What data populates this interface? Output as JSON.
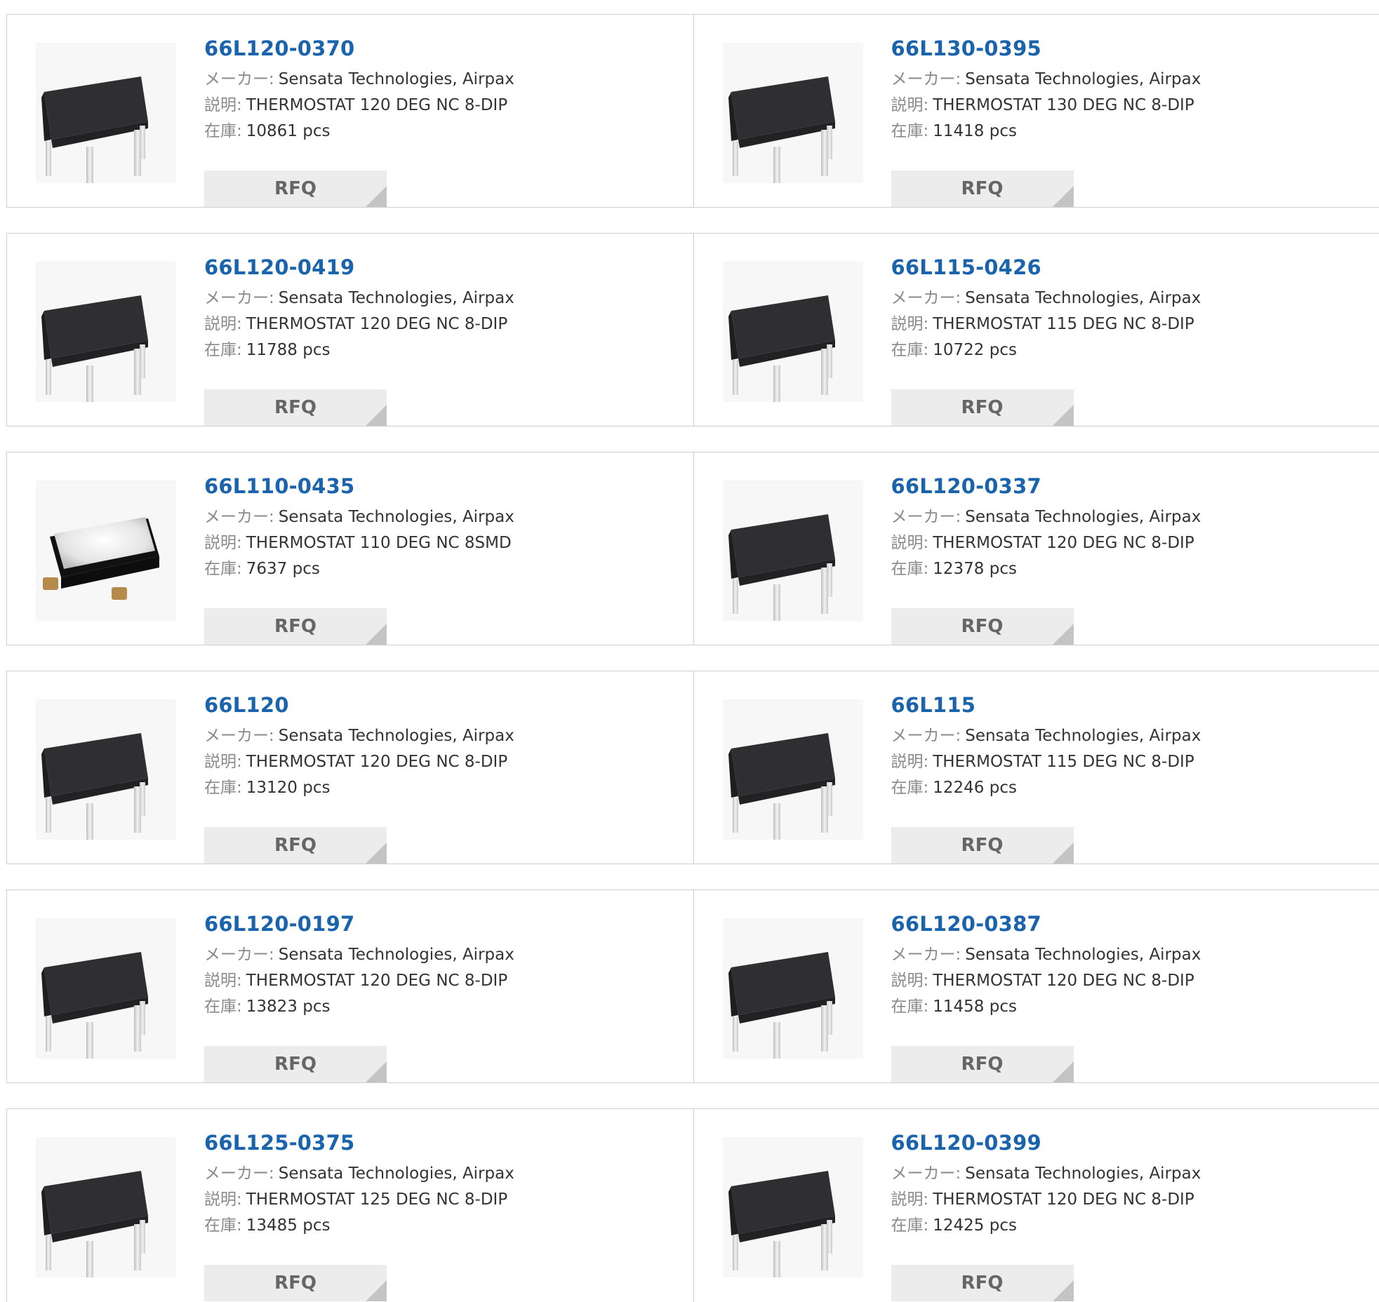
{
  "products": [
    {
      "part": "66L120-0370",
      "maker_label": "メーカー:",
      "maker": "Sensata Technologies, Airpax",
      "desc_label": "説明:",
      "desc": "THERMOSTAT 120 DEG NC 8-DIP",
      "stock_label": "在庫:",
      "stock": "10861 pcs",
      "rfq": "RFQ",
      "image": "dip-thermostat-icon"
    },
    {
      "part": "66L130-0395",
      "maker_label": "メーカー:",
      "maker": "Sensata Technologies, Airpax",
      "desc_label": "説明:",
      "desc": "THERMOSTAT 130 DEG NC 8-DIP",
      "stock_label": "在庫:",
      "stock": "11418 pcs",
      "rfq": "RFQ",
      "image": "dip-thermostat-icon"
    },
    {
      "part": "66L120-0419",
      "maker_label": "メーカー:",
      "maker": "Sensata Technologies, Airpax",
      "desc_label": "説明:",
      "desc": "THERMOSTAT 120 DEG NC 8-DIP",
      "stock_label": "在庫:",
      "stock": "11788 pcs",
      "rfq": "RFQ",
      "image": "dip-thermostat-icon"
    },
    {
      "part": "66L115-0426",
      "maker_label": "メーカー:",
      "maker": "Sensata Technologies, Airpax",
      "desc_label": "説明:",
      "desc": "THERMOSTAT 115 DEG NC 8-DIP",
      "stock_label": "在庫:",
      "stock": "10722 pcs",
      "rfq": "RFQ",
      "image": "dip-thermostat-icon"
    },
    {
      "part": "66L110-0435",
      "maker_label": "メーカー:",
      "maker": "Sensata Technologies, Airpax",
      "desc_label": "説明:",
      "desc": "THERMOSTAT 110 DEG NC 8SMD",
      "stock_label": "在庫:",
      "stock": "7637 pcs",
      "rfq": "RFQ",
      "image": "smd-thermostat-icon"
    },
    {
      "part": "66L120-0337",
      "maker_label": "メーカー:",
      "maker": "Sensata Technologies, Airpax",
      "desc_label": "説明:",
      "desc": "THERMOSTAT 120 DEG NC 8-DIP",
      "stock_label": "在庫:",
      "stock": "12378 pcs",
      "rfq": "RFQ",
      "image": "dip-thermostat-icon"
    },
    {
      "part": "66L120",
      "maker_label": "メーカー:",
      "maker": "Sensata Technologies, Airpax",
      "desc_label": "説明:",
      "desc": "THERMOSTAT 120 DEG NC 8-DIP",
      "stock_label": "在庫:",
      "stock": "13120 pcs",
      "rfq": "RFQ",
      "image": "dip-thermostat-icon"
    },
    {
      "part": "66L115",
      "maker_label": "メーカー:",
      "maker": "Sensata Technologies, Airpax",
      "desc_label": "説明:",
      "desc": "THERMOSTAT 115 DEG NC 8-DIP",
      "stock_label": "在庫:",
      "stock": "12246 pcs",
      "rfq": "RFQ",
      "image": "dip-thermostat-icon"
    },
    {
      "part": "66L120-0197",
      "maker_label": "メーカー:",
      "maker": "Sensata Technologies, Airpax",
      "desc_label": "説明:",
      "desc": "THERMOSTAT 120 DEG NC 8-DIP",
      "stock_label": "在庫:",
      "stock": "13823 pcs",
      "rfq": "RFQ",
      "image": "dip-thermostat-icon"
    },
    {
      "part": "66L120-0387",
      "maker_label": "メーカー:",
      "maker": "Sensata Technologies, Airpax",
      "desc_label": "説明:",
      "desc": "THERMOSTAT 120 DEG NC 8-DIP",
      "stock_label": "在庫:",
      "stock": "11458 pcs",
      "rfq": "RFQ",
      "image": "dip-thermostat-icon"
    },
    {
      "part": "66L125-0375",
      "maker_label": "メーカー:",
      "maker": "Sensata Technologies, Airpax",
      "desc_label": "説明:",
      "desc": "THERMOSTAT 125 DEG NC 8-DIP",
      "stock_label": "在庫:",
      "stock": "13485 pcs",
      "rfq": "RFQ",
      "image": "dip-thermostat-icon"
    },
    {
      "part": "66L120-0399",
      "maker_label": "メーカー:",
      "maker": "Sensata Technologies, Airpax",
      "desc_label": "説明:",
      "desc": "THERMOSTAT 120 DEG NC 8-DIP",
      "stock_label": "在庫:",
      "stock": "12425 pcs",
      "rfq": "RFQ",
      "image": "dip-thermostat-icon"
    }
  ],
  "colors": {
    "part_link": "#1a63ad",
    "label": "#8a8a8a",
    "value": "#333333",
    "rfq_bg": "#ececec",
    "rfq_text": "#666666",
    "border": "#cfcfcf"
  }
}
